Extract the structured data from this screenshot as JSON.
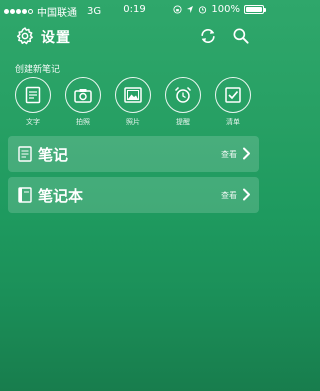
{
  "status_bar": {
    "carrier": "中国联通",
    "network": "3G",
    "time": "0:19",
    "battery": "100%",
    "battery_level": 1.0,
    "signal_strength": 4,
    "signal_max": 5
  },
  "header": {
    "title": "设置",
    "icons": [
      "gear-icon",
      "sync-icon",
      "search-icon"
    ]
  },
  "create_section": {
    "label": "创建新笔记",
    "items": [
      {
        "label": "文字",
        "icon": "text-note-icon"
      },
      {
        "label": "拍照",
        "icon": "camera-icon"
      },
      {
        "label": "照片",
        "icon": "photo-icon"
      },
      {
        "label": "提醒",
        "icon": "alarm-clock-icon"
      },
      {
        "label": "清单",
        "icon": "checklist-icon"
      }
    ]
  },
  "list": [
    {
      "title": "笔记",
      "action": "查看",
      "icon": "note-icon"
    },
    {
      "title": "笔记本",
      "action": "查看",
      "icon": "notebook-icon"
    }
  ],
  "colors": {
    "background_top": "#2fa76b",
    "background_bottom": "#187d4d",
    "foreground": "#ffffff"
  }
}
